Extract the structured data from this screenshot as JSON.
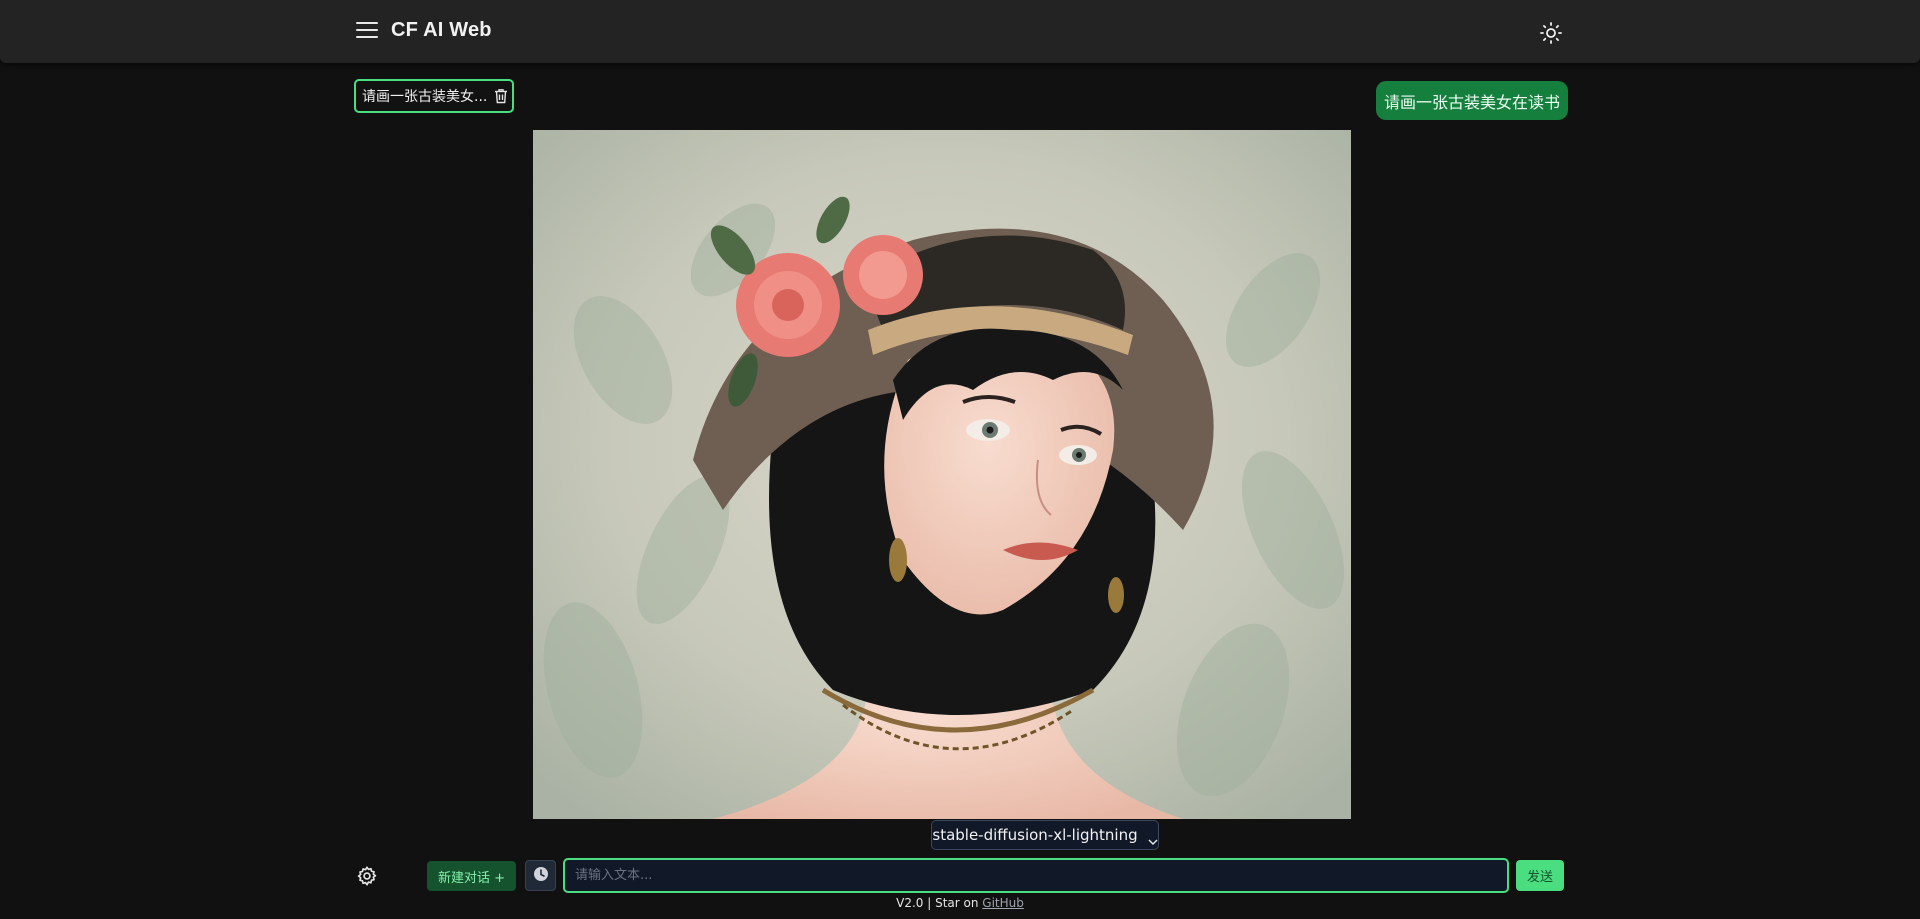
{
  "header": {
    "title": "CF AI Web",
    "menu_icon": "hamburger-menu-icon",
    "theme_icon": "sun-icon"
  },
  "history": {
    "chip_label": "请画一张古装美女...",
    "delete_icon": "trash-icon"
  },
  "chat": {
    "user_message": "请画一张古装美女在读书"
  },
  "model": {
    "selected": "stable-diffusion-xl-lightning",
    "chevron_icon": "chevron-down-icon"
  },
  "composer": {
    "settings_icon": "gear-icon",
    "new_chat_label": "新建对话 +",
    "history_icon": "clock-icon",
    "input_value": "",
    "input_placeholder": "请输入文本...",
    "send_label": "发送"
  },
  "footer": {
    "version_text": "V2.0 | Star on",
    "github_link": "GitHub"
  },
  "colors": {
    "accent": "#4ade80",
    "bubble": "#15803d",
    "background": "#111111",
    "topbar": "#232323"
  }
}
